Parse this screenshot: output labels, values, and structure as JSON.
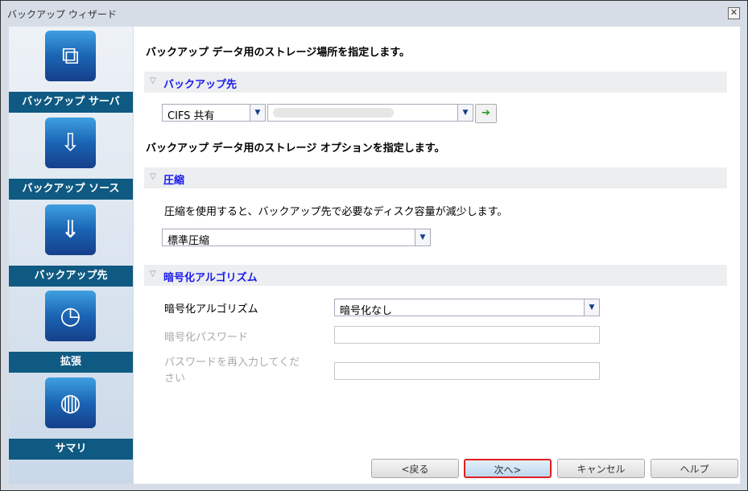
{
  "window": {
    "title": "バックアップ ウィザード",
    "close": "✕"
  },
  "sidebar": {
    "items": [
      {
        "label": "バックアップ サーバ",
        "icon": "server-hierarchy-icon",
        "glyph": "⧉"
      },
      {
        "label": "バックアップ ソース",
        "icon": "drive-export-icon",
        "glyph": "⇩"
      },
      {
        "label": "バックアップ先",
        "icon": "drive-import-icon",
        "glyph": "⇓"
      },
      {
        "label": "拡張",
        "icon": "clock-icon",
        "glyph": "◷"
      },
      {
        "label": "サマリ",
        "icon": "globe-icon",
        "glyph": "◍"
      }
    ]
  },
  "main": {
    "heading1": "バックアップ データ用のストレージ場所を指定します。",
    "dest_section": "バックアップ先",
    "dest_type": "CIFS 共有",
    "dest_path": "",
    "heading2": "バックアップ データ用のストレージ オプションを指定します。",
    "compress_section": "圧縮",
    "compress_desc": "圧縮を使用すると、バックアップ先で必要なディスク容量が減少します。",
    "compress_value": "標準圧縮",
    "enc_section": "暗号化アルゴリズム",
    "enc_label": "暗号化アルゴリズム",
    "enc_value": "暗号化なし",
    "pw_label": "暗号化パスワード",
    "pw2_label": "パスワードを再入力してください"
  },
  "buttons": {
    "back": "<戻る",
    "next": "次へ>",
    "cancel": "キャンセル",
    "help": "ヘルプ"
  },
  "colors": {
    "accent": "#0f5a82",
    "section_title": "#1a1aee",
    "focus": "#e02020"
  }
}
